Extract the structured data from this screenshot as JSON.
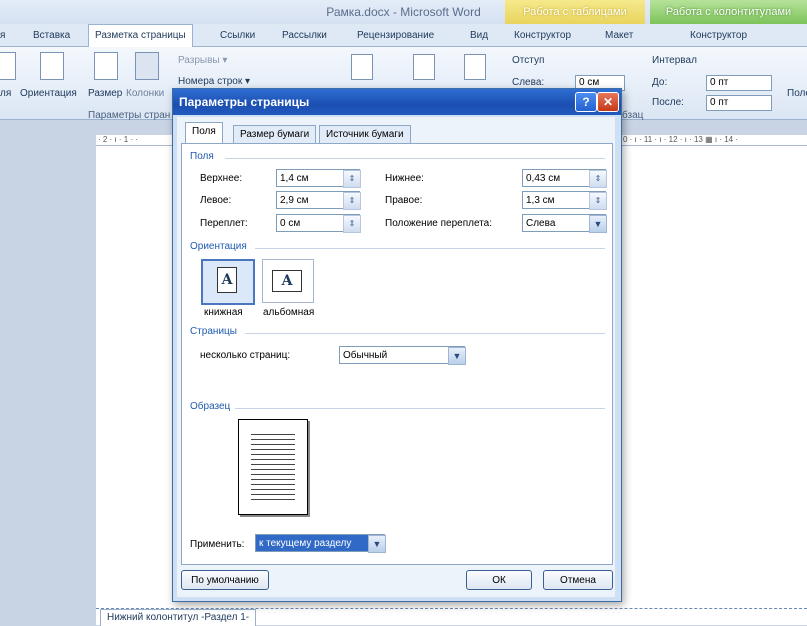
{
  "app": {
    "title": "Рамка.docx - Microsoft Word"
  },
  "context_tabs": {
    "table_tools": "Работа с таблицами",
    "header_footer_tools": "Работа с колонтитулами"
  },
  "ribbon_tabs": [
    "я",
    "Вставка",
    "Разметка страницы",
    "Ссылки",
    "Рассылки",
    "Рецензирование",
    "Вид",
    "Конструктор",
    "Макет",
    "Конструктор"
  ],
  "ribbon": {
    "breaks": "Разрывы ▾",
    "line_numbers": "Номера строк ▾",
    "btn_fields": "ля",
    "btn_orientation": "Ориентация",
    "btn_size": "Размер",
    "btn_columns": "Колонки",
    "group_page_setup": "Параметры стран",
    "indent_label": "Отступ",
    "indent_left_label": "Слева:",
    "indent_left_value": "0 см",
    "spacing_label": "Интервал",
    "spacing_before_label": "До:",
    "spacing_before_value": "0 пт",
    "spacing_after_label": "После:",
    "spacing_after_value": "0 пт",
    "group_paragraph": "бзац",
    "right_cut": "Поле"
  },
  "ruler": {
    "left_text": "· 2 · ı · 1 · ·",
    "right_text": "0 · ı · 11 · ı · 12 · ı · 13 ▦ ı · 14 ·"
  },
  "dialog": {
    "title": "Параметры страницы",
    "help": "?",
    "close": "✕",
    "tabs": [
      "Поля",
      "Размер бумаги",
      "Источник бумаги"
    ],
    "margins_section": "Поля",
    "top_label": "Верхнее:",
    "top_value": "1,4 см",
    "bottom_label": "Нижнее:",
    "bottom_value": "0,43 см",
    "left_label": "Левое:",
    "left_value": "2,9 см",
    "right_label": "Правое:",
    "right_value": "1,3 см",
    "gutter_label": "Переплет:",
    "gutter_value": "0 см",
    "gutter_pos_label": "Положение переплета:",
    "gutter_pos_value": "Слева",
    "orientation_section": "Ориентация",
    "portrait_label": "книжная",
    "landscape_label": "альбомная",
    "orientation_letter": "A",
    "pages_section": "Страницы",
    "multiple_pages_label": "несколько страниц:",
    "multiple_pages_value": "Обычный",
    "preview_section": "Образец",
    "apply_label": "Применить:",
    "apply_value": "к текущему разделу",
    "default_btn": "По умолчанию",
    "ok_btn": "ОК",
    "cancel_btn": "Отмена"
  },
  "document": {
    "footer_tab": "Нижний колонтитул -Раздел 1-"
  }
}
